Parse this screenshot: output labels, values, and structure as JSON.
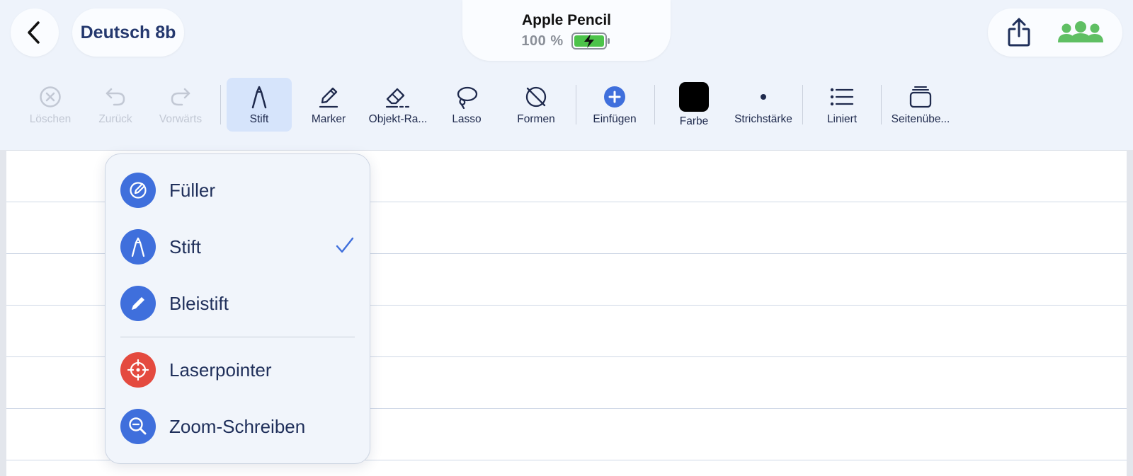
{
  "header": {
    "back_icon": "chevron-left-icon",
    "title": "Deutsch 8b",
    "pencil": {
      "name": "Apple Pencil",
      "battery_text": "100 %",
      "battery_level": 1.0,
      "battery_state": "charging"
    },
    "share_icon": "share-icon",
    "collab_icon": "people-icon"
  },
  "toolbar": {
    "delete": "Löschen",
    "undo": "Zurück",
    "redo": "Vorwärts",
    "pen": "Stift",
    "marker": "Marker",
    "eraser": "Objekt-Ra...",
    "lasso": "Lasso",
    "shapes": "Formen",
    "insert": "Einfügen",
    "color": "Farbe",
    "stroke": "Strichstärke",
    "ruled": "Liniert",
    "pages": "Seitenübe..."
  },
  "menu": {
    "items": [
      {
        "label": "Füller",
        "icon": "fountain-pen-icon"
      },
      {
        "label": "Stift",
        "icon": "pen-icon",
        "selected": true
      },
      {
        "label": "Bleistift",
        "icon": "pencil-icon"
      },
      {
        "label": "Laserpointer",
        "icon": "crosshair-icon"
      },
      {
        "label": "Zoom-Schreiben",
        "icon": "zoom-icon"
      }
    ]
  },
  "colors": {
    "accent": "#3f6fdc",
    "laser": "#e44a3f",
    "collab_green": "#5fbf63",
    "battery_green": "#4cc34a",
    "selected_color": "#000000"
  }
}
